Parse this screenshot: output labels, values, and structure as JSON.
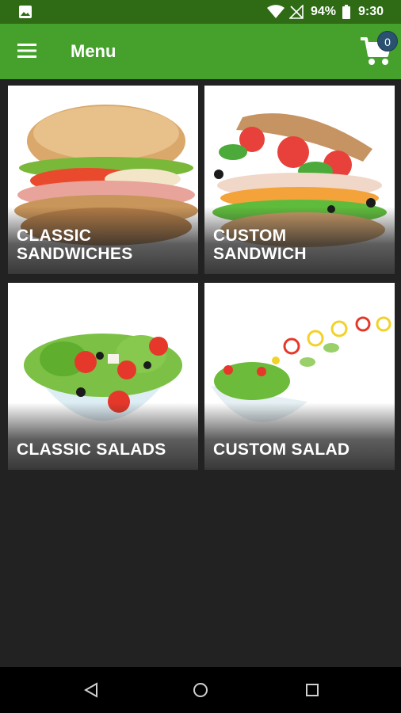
{
  "status_bar": {
    "battery": "94%",
    "time": "9:30",
    "icons": [
      "photo-icon",
      "wifi-icon",
      "signal-off-icon",
      "battery-icon"
    ]
  },
  "app_bar": {
    "title": "Menu",
    "cart_count": "0",
    "icons": [
      "hamburger-menu-icon",
      "shopping-cart-icon"
    ]
  },
  "menu": {
    "items": [
      {
        "label": "CLASSIC\nSANDWICHES"
      },
      {
        "label": "CUSTOM\nSANDWICH"
      },
      {
        "label": "CLASSIC SALADS"
      },
      {
        "label": "CUSTOM SALAD"
      }
    ]
  },
  "nav_bar": {
    "icons": [
      "back-icon",
      "home-icon",
      "recents-icon"
    ]
  },
  "colors": {
    "status_bar": "#2e6b14",
    "app_bar": "#45a12c",
    "background": "#222222",
    "badge": "#2a5170"
  }
}
